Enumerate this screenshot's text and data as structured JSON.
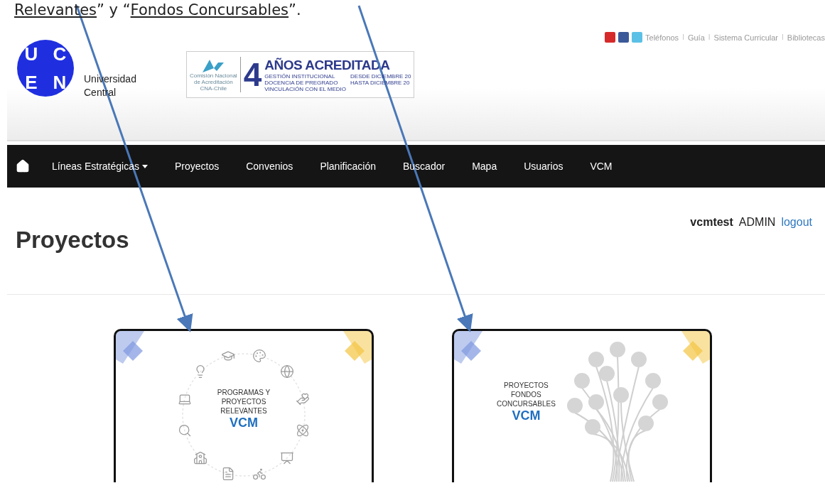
{
  "document_caption": {
    "parts": [
      {
        "text": "Relevantes",
        "underlined": true
      },
      {
        "text": "” y “",
        "underlined": false
      },
      {
        "text": "Fondos Concursables",
        "underlined": true
      },
      {
        "text": "”.",
        "underlined": false
      }
    ]
  },
  "header": {
    "logo": {
      "letters": [
        "U",
        "C",
        "E",
        "N"
      ],
      "name_lines": [
        "Universidad",
        "Central"
      ]
    },
    "accreditation": {
      "agency_lines": [
        "Comisión Nacional",
        "de Acreditación",
        "CNA-Chile"
      ],
      "years": "4",
      "headline": "AÑOS ACREDITADA",
      "areas": [
        "GESTIÓN INSTITUCIONAL",
        "DOCENCIA DE PREGRADO",
        "VINCULACIÓN CON EL MEDIO"
      ],
      "period": [
        "DESDE DICIEMBRE 20",
        "HASTA DICIEMBRE 20"
      ]
    },
    "top_links": [
      {
        "kind": "link",
        "text": "Teléfonos"
      },
      {
        "kind": "separator",
        "text": "I"
      },
      {
        "kind": "link",
        "text": "Guía"
      },
      {
        "kind": "separator",
        "text": "I"
      },
      {
        "kind": "link",
        "text": "Sistema Curricular"
      },
      {
        "kind": "separator",
        "text": "I"
      },
      {
        "kind": "link",
        "text": "Bibliotecas"
      }
    ]
  },
  "nav": {
    "items": [
      {
        "label": "Líneas Estratégicas",
        "has_caret": true
      },
      {
        "label": "Proyectos",
        "has_caret": false
      },
      {
        "label": "Convenios",
        "has_caret": false
      },
      {
        "label": "Planificación",
        "has_caret": false
      },
      {
        "label": "Buscador",
        "has_caret": false
      },
      {
        "label": "Mapa",
        "has_caret": false
      },
      {
        "label": "Usuarios",
        "has_caret": false
      },
      {
        "label": "VCM",
        "has_caret": false
      }
    ]
  },
  "user": {
    "name": "vcmtest",
    "role": "ADMIN",
    "logout": "logout"
  },
  "page_title": "Proyectos",
  "cards": [
    {
      "kind": "ring",
      "title_lines": [
        "PROGRAMAS Y",
        "PROYECTOS",
        "RELEVANTES"
      ],
      "tag": "VCM"
    },
    {
      "kind": "tree",
      "title_lines": [
        "PROYECTOS",
        "FONDOS",
        "CONCURSABLES"
      ],
      "tag": "VCM"
    }
  ]
}
